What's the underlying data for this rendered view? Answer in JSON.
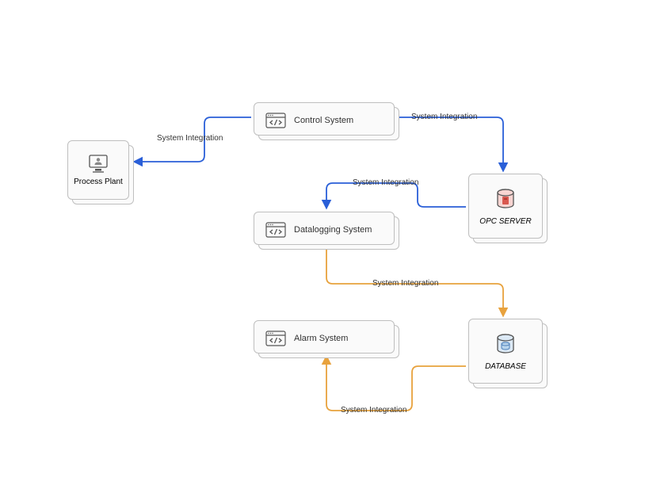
{
  "nodes": {
    "process_plant": {
      "label": "Process Plant"
    },
    "control_system": {
      "label": "Control System"
    },
    "opc_server": {
      "label": "OPC SERVER"
    },
    "datalogging_system": {
      "label": "Datalogging System"
    },
    "alarm_system": {
      "label": "Alarm System"
    },
    "database": {
      "label": "DATABASE"
    }
  },
  "edges": {
    "e1": {
      "label": "System Integration"
    },
    "e2": {
      "label": "System Integration"
    },
    "e3": {
      "label": "System Integration"
    },
    "e4": {
      "label": "System Integration"
    },
    "e5": {
      "label": "System Integration"
    }
  },
  "colors": {
    "blue": "#2a5fd8",
    "orange": "#e8a23d",
    "node_border": "#bfbfbf",
    "node_fill": "#fafafa"
  }
}
